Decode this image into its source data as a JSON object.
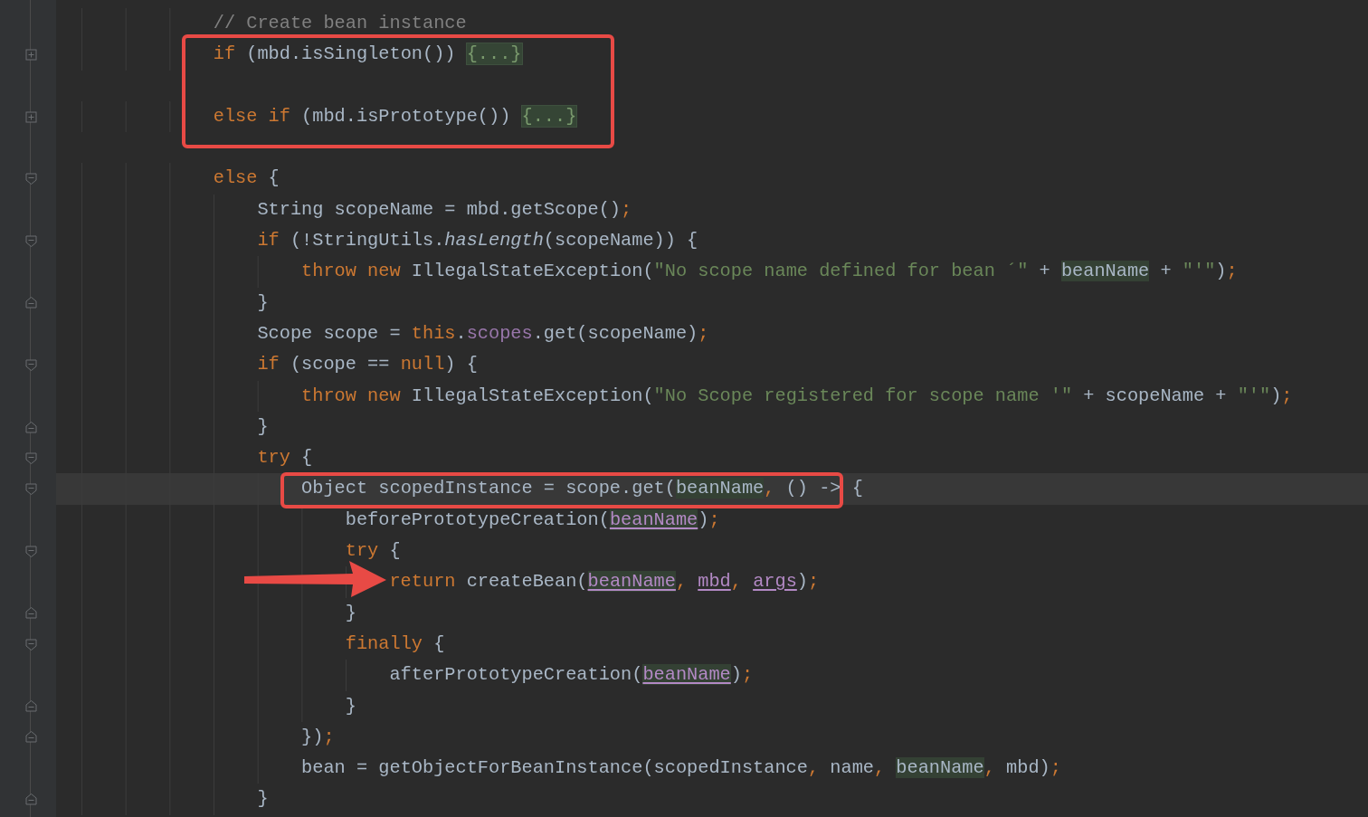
{
  "editor": {
    "lines": [
      {
        "current": false,
        "tokens": [
          {
            "kind": "comment",
            "text": "                // Create bean instance"
          }
        ]
      },
      {
        "fold": {
          "kind": "expand"
        },
        "current": false,
        "tokens": [
          {
            "kind": "keyword",
            "text": "                if"
          },
          {
            "kind": "plain",
            "text": " (mbd.isSingleton()) "
          },
          {
            "kind": "folded",
            "text": "{...}"
          }
        ]
      },
      {
        "current": false
      },
      {
        "fold": {
          "kind": "expand"
        },
        "current": false,
        "tokens": [
          {
            "kind": "keyword",
            "text": "                else if"
          },
          {
            "kind": "plain",
            "text": " (mbd.isPrototype()) "
          },
          {
            "kind": "folded",
            "text": "{...}"
          }
        ]
      },
      {
        "current": false
      },
      {
        "fold": {
          "kind": "open"
        },
        "current": false,
        "tokens": [
          {
            "kind": "keyword",
            "text": "                else"
          },
          {
            "kind": "plain",
            "text": " {"
          }
        ]
      },
      {
        "current": false,
        "tokens": [
          {
            "kind": "plain",
            "text": "                    String scopeName = mbd.getScope()"
          },
          {
            "kind": "keyword",
            "text": ";"
          }
        ]
      },
      {
        "fold": {
          "kind": "open"
        },
        "current": false,
        "tokens": [
          {
            "kind": "keyword",
            "text": "                    if"
          },
          {
            "kind": "plain",
            "text": " (!StringUtils."
          },
          {
            "kind": "italic",
            "text": "hasLength"
          },
          {
            "kind": "plain",
            "text": "(scopeName)) {"
          }
        ]
      },
      {
        "current": false,
        "tokens": [
          {
            "kind": "keyword",
            "text": "                        throw new"
          },
          {
            "kind": "plain",
            "text": " IllegalStateException("
          },
          {
            "kind": "string",
            "text": "\"No scope name defined for bean ´\""
          },
          {
            "kind": "plain",
            "text": " + "
          },
          {
            "kind": "usage",
            "text": "beanName"
          },
          {
            "kind": "plain",
            "text": " + "
          },
          {
            "kind": "string",
            "text": "\"'\""
          },
          {
            "kind": "plain",
            "text": ")"
          },
          {
            "kind": "keyword",
            "text": ";"
          }
        ]
      },
      {
        "fold": {
          "kind": "close"
        },
        "current": false,
        "tokens": [
          {
            "kind": "plain",
            "text": "                    }"
          }
        ]
      },
      {
        "current": false,
        "tokens": [
          {
            "kind": "plain",
            "text": "                    Scope scope = "
          },
          {
            "kind": "keyword",
            "text": "this"
          },
          {
            "kind": "plain",
            "text": "."
          },
          {
            "kind": "field",
            "text": "scopes"
          },
          {
            "kind": "plain",
            "text": ".get(scopeName)"
          },
          {
            "kind": "keyword",
            "text": ";"
          }
        ]
      },
      {
        "fold": {
          "kind": "open"
        },
        "current": false,
        "tokens": [
          {
            "kind": "keyword",
            "text": "                    if"
          },
          {
            "kind": "plain",
            "text": " (scope == "
          },
          {
            "kind": "keyword",
            "text": "null"
          },
          {
            "kind": "plain",
            "text": ") {"
          }
        ]
      },
      {
        "current": false,
        "tokens": [
          {
            "kind": "keyword",
            "text": "                        throw new"
          },
          {
            "kind": "plain",
            "text": " IllegalStateException("
          },
          {
            "kind": "string",
            "text": "\"No Scope registered for scope name '\""
          },
          {
            "kind": "plain",
            "text": " + scopeName + "
          },
          {
            "kind": "string",
            "text": "\"'\""
          },
          {
            "kind": "plain",
            "text": ")"
          },
          {
            "kind": "keyword",
            "text": ";"
          }
        ]
      },
      {
        "fold": {
          "kind": "close"
        },
        "current": false,
        "tokens": [
          {
            "kind": "plain",
            "text": "                    }"
          }
        ]
      },
      {
        "fold": {
          "kind": "open"
        },
        "current": false,
        "tokens": [
          {
            "kind": "keyword",
            "text": "                    try"
          },
          {
            "kind": "plain",
            "text": " {"
          }
        ]
      },
      {
        "fold": {
          "kind": "open"
        },
        "current": true,
        "tokens": [
          {
            "kind": "plain",
            "text": "                        Object scopedInstance = scope.get("
          },
          {
            "kind": "usage",
            "text": "beanName"
          },
          {
            "kind": "keyword",
            "text": ","
          },
          {
            "kind": "plain",
            "text": " () -> {"
          }
        ]
      },
      {
        "current": false,
        "tokens": [
          {
            "kind": "plain",
            "text": "                            beforePrototypeCreation("
          },
          {
            "kind": "param-usage",
            "text": "beanName"
          },
          {
            "kind": "plain",
            "text": ")"
          },
          {
            "kind": "keyword",
            "text": ";"
          }
        ]
      },
      {
        "fold": {
          "kind": "open"
        },
        "current": false,
        "tokens": [
          {
            "kind": "keyword",
            "text": "                            try"
          },
          {
            "kind": "plain",
            "text": " {"
          }
        ]
      },
      {
        "current": false,
        "tokens": [
          {
            "kind": "keyword",
            "text": "                                return"
          },
          {
            "kind": "plain",
            "text": " createBean("
          },
          {
            "kind": "param-usage",
            "text": "beanName"
          },
          {
            "kind": "keyword",
            "text": ", "
          },
          {
            "kind": "param",
            "text": "mbd"
          },
          {
            "kind": "keyword",
            "text": ", "
          },
          {
            "kind": "param",
            "text": "args"
          },
          {
            "kind": "plain",
            "text": ")"
          },
          {
            "kind": "keyword",
            "text": ";"
          }
        ]
      },
      {
        "fold": {
          "kind": "close"
        },
        "current": false,
        "tokens": [
          {
            "kind": "plain",
            "text": "                            }"
          }
        ]
      },
      {
        "fold": {
          "kind": "open"
        },
        "current": false,
        "tokens": [
          {
            "kind": "keyword",
            "text": "                            finally"
          },
          {
            "kind": "plain",
            "text": " {"
          }
        ]
      },
      {
        "current": false,
        "tokens": [
          {
            "kind": "plain",
            "text": "                                afterPrototypeCreation("
          },
          {
            "kind": "param-usage",
            "text": "beanName"
          },
          {
            "kind": "plain",
            "text": ")"
          },
          {
            "kind": "keyword",
            "text": ";"
          }
        ]
      },
      {
        "fold": {
          "kind": "close"
        },
        "current": false,
        "tokens": [
          {
            "kind": "plain",
            "text": "                            }"
          }
        ]
      },
      {
        "fold": {
          "kind": "close"
        },
        "current": false,
        "tokens": [
          {
            "kind": "plain",
            "text": "                        })"
          },
          {
            "kind": "keyword",
            "text": ";"
          }
        ]
      },
      {
        "current": false,
        "tokens": [
          {
            "kind": "plain",
            "text": "                        bean = getObjectForBeanInstance(scopedInstance"
          },
          {
            "kind": "keyword",
            "text": ","
          },
          {
            "kind": "plain",
            "text": " name"
          },
          {
            "kind": "keyword",
            "text": ", "
          },
          {
            "kind": "usage",
            "text": "beanName"
          },
          {
            "kind": "keyword",
            "text": ","
          },
          {
            "kind": "plain",
            "text": " mbd)"
          },
          {
            "kind": "keyword",
            "text": ";"
          }
        ]
      },
      {
        "fold": {
          "kind": "close"
        },
        "current": false,
        "tokens": [
          {
            "kind": "plain",
            "text": "                    }"
          }
        ]
      }
    ]
  },
  "annotations": [
    {
      "kind": "frame"
    },
    {
      "kind": "frame"
    },
    {
      "kind": "arrow"
    }
  ]
}
